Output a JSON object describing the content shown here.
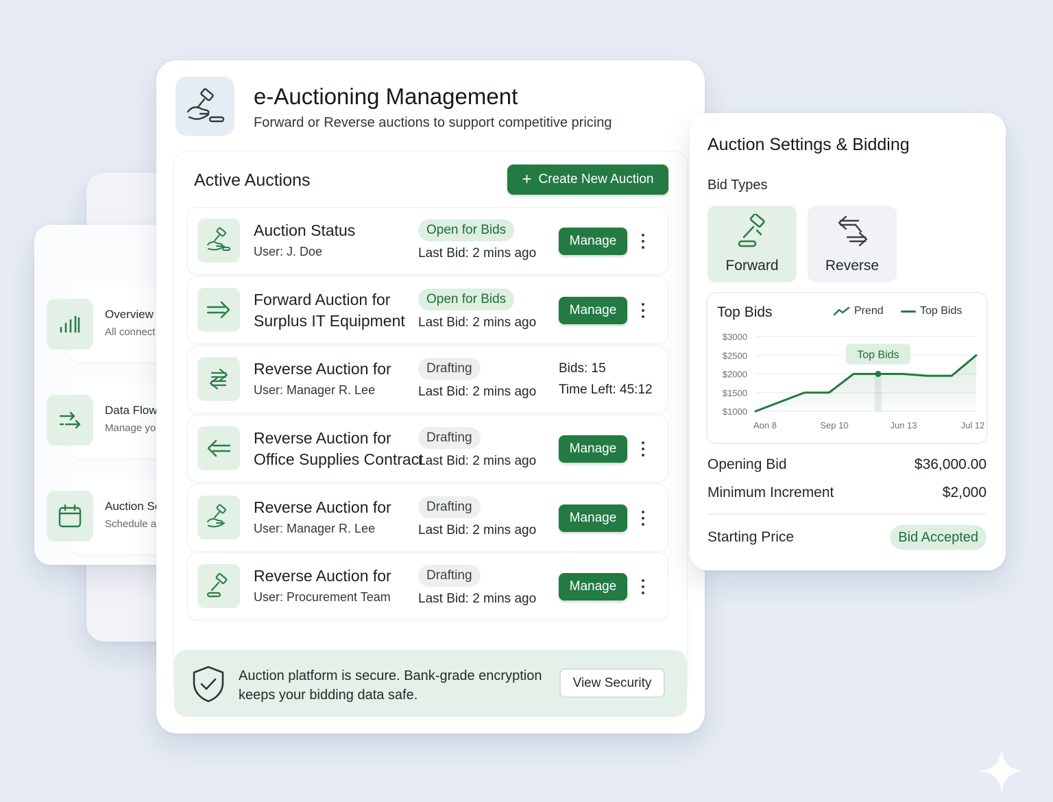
{
  "sidebar": {
    "items": [
      {
        "title": "Overview",
        "subtitle": "All connect",
        "icon": "bar-chart-icon"
      },
      {
        "title": "Data Flow",
        "subtitle": "Manage yo",
        "icon": "arrows-right-icon"
      },
      {
        "title": "Auction Sc",
        "subtitle": "Schedule a",
        "icon": "calendar-icon"
      }
    ]
  },
  "header": {
    "title": "e-Auctioning Management",
    "subtitle": "Forward or Reverse auctions to support competitive pricing",
    "logo_icon": "gavel-hand-icon"
  },
  "auctions": {
    "title": "Active Auctions",
    "create_label": "Create New Auction",
    "manage_label": "Manage",
    "rows": [
      {
        "title": "Auction Status",
        "title2": "",
        "user": "User: J. Doe",
        "status": "Open for Bids",
        "status_type": "open",
        "last_bid": "Last Bid: 2 mins ago",
        "icon": "gavel-hand-icon"
      },
      {
        "title": "Forward Auction for",
        "title2": "Surplus IT Equipment",
        "user": "",
        "status": "Open for Bids",
        "status_type": "open",
        "last_bid": "Last Bid: 2 mins ago",
        "icon": "arrow-right-icon"
      },
      {
        "title": "Reverse Auction for",
        "title2": "",
        "user": "User: Manager R. Lee",
        "status": "Drafting",
        "status_type": "draft",
        "last_bid": "Last Bid: 2 mins ago",
        "icon": "swap-arrows-icon",
        "bids": "Bids: 15",
        "time_left": "Time Left: 45:12"
      },
      {
        "title": "Reverse Auction for",
        "title2": "Office Supplies Contract",
        "user": "",
        "status": "Drafting",
        "status_type": "draft",
        "last_bid": "Last Bid: 2 mins ago",
        "icon": "arrow-left-icon"
      },
      {
        "title": "Reverse Auction for",
        "title2": "",
        "user": "User: Manager R. Lee",
        "status": "Drafting",
        "status_type": "draft",
        "last_bid": "Last Bid: 2 mins ago",
        "icon": "gavel-hand-icon"
      },
      {
        "title": "Reverse Auction for",
        "title2": "",
        "user": "User: Procurement Team",
        "status": "Drafting",
        "status_type": "draft",
        "last_bid": "Last Bid: 2 mins ago",
        "icon": "gavel-icon"
      }
    ]
  },
  "security": {
    "text": "Auction platform is secure. Bank-grade encryption keeps your bidding data safe.",
    "button_label": "View Security",
    "icon": "shield-check-icon"
  },
  "settings": {
    "title": "Auction Settings & Bidding",
    "bid_types_label": "Bid Types",
    "bid_types": [
      {
        "label": "Forward",
        "icon": "gavel-icon",
        "active": true
      },
      {
        "label": "Reverse",
        "icon": "swap-arrows-icon",
        "active": false
      }
    ],
    "opening_bid_label": "Opening Bid",
    "opening_bid_value": "$36,000.00",
    "min_increment_label": "Minimum Increment",
    "min_increment_value": "$2,000",
    "starting_price_label": "Starting Price",
    "starting_price_status": "Bid Accepted"
  },
  "colors": {
    "accent": "#237a43",
    "accent_light": "#dcefe1",
    "background": "#e6ebf4"
  },
  "chart_data": {
    "type": "line",
    "title": "Top Bids",
    "legend": [
      "Prend",
      "Top Bids"
    ],
    "legend_placement": "top-right",
    "x_tick_labels": [
      "Aon 8",
      "Sep 10",
      "Jun 13",
      "Jul 12"
    ],
    "y_tick_labels": [
      "$3000",
      "$2500",
      "$2000",
      "$1500",
      "$1000"
    ],
    "ylim": [
      1000,
      3000
    ],
    "grid": true,
    "annotation": "Top Bids",
    "series": [
      {
        "name": "Top Bids",
        "x": [
          0,
          1,
          2,
          3,
          4,
          5,
          6,
          7,
          8,
          9
        ],
        "values": [
          1000,
          1250,
          1500,
          1500,
          2000,
          2000,
          2000,
          1950,
          1950,
          2500
        ]
      }
    ],
    "highlight_index": 5
  }
}
